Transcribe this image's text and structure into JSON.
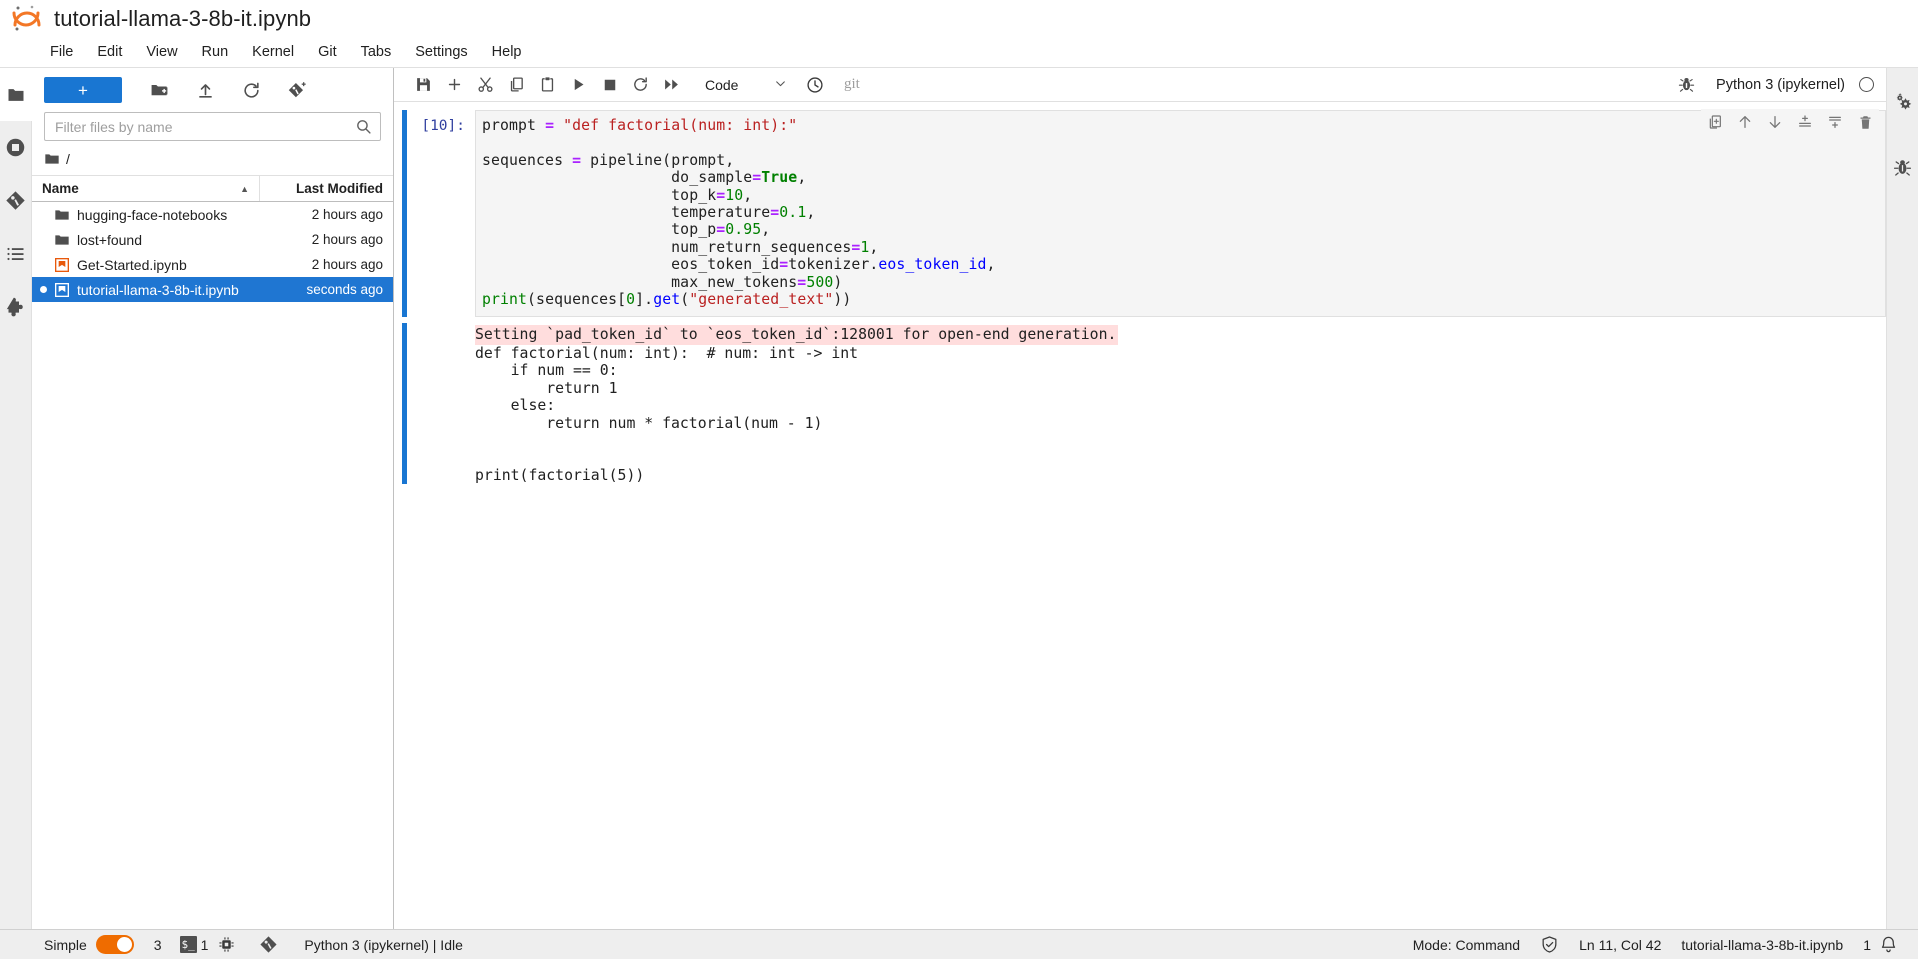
{
  "window": {
    "logo": "jupyter-logo",
    "title": "tutorial-llama-3-8b-it.ipynb"
  },
  "menubar": {
    "items": [
      {
        "label": "File",
        "name": "menu-file"
      },
      {
        "label": "Edit",
        "name": "menu-edit"
      },
      {
        "label": "View",
        "name": "menu-view"
      },
      {
        "label": "Run",
        "name": "menu-run"
      },
      {
        "label": "Kernel",
        "name": "menu-kernel"
      },
      {
        "label": "Git",
        "name": "menu-git"
      },
      {
        "label": "Tabs",
        "name": "menu-tabs"
      },
      {
        "label": "Settings",
        "name": "menu-settings"
      },
      {
        "label": "Help",
        "name": "menu-help"
      }
    ]
  },
  "left_sidebar": {
    "items": [
      {
        "name": "file-browser-icon",
        "icon": "folder",
        "active": true
      },
      {
        "name": "running-terminals-icon",
        "icon": "stop-circle",
        "active": false
      },
      {
        "name": "git-icon",
        "icon": "git-diamond",
        "active": false
      },
      {
        "name": "table-of-contents-icon",
        "icon": "list",
        "active": false
      },
      {
        "name": "extension-manager-icon",
        "icon": "puzzle",
        "active": false
      }
    ]
  },
  "right_sidebar": {
    "items": [
      {
        "name": "property-inspector-icon",
        "icon": "gears"
      },
      {
        "name": "debugger-icon",
        "icon": "bug"
      }
    ]
  },
  "filebrowser": {
    "toolbar": {
      "new_launcher_label": "+",
      "new_folder_name": "new-folder-icon",
      "upload_name": "upload-icon",
      "refresh_name": "refresh-icon",
      "new_checkpoint_name": "git-clone-icon"
    },
    "filter": {
      "placeholder": "Filter files by name",
      "value": ""
    },
    "breadcrumb": "/",
    "columns": {
      "name": "Name",
      "last_modified": "Last Modified"
    },
    "rows": [
      {
        "name": "hugging-face-notebooks",
        "modified": "2 hours ago",
        "kind": "folder",
        "selected": false,
        "dirty": false
      },
      {
        "name": "lost+found",
        "modified": "2 hours ago",
        "kind": "folder",
        "selected": false,
        "dirty": false
      },
      {
        "name": "Get-Started.ipynb",
        "modified": "2 hours ago",
        "kind": "notebook",
        "selected": false,
        "dirty": false
      },
      {
        "name": "tutorial-llama-3-8b-it.ipynb",
        "modified": "seconds ago",
        "kind": "notebook",
        "selected": true,
        "dirty": true
      }
    ]
  },
  "notebook_toolbar": {
    "buttons": [
      {
        "name": "save-button",
        "icon": "save"
      },
      {
        "name": "insert-cell-button",
        "icon": "plus"
      },
      {
        "name": "cut-cell-button",
        "icon": "scissors"
      },
      {
        "name": "copy-cell-button",
        "icon": "copy"
      },
      {
        "name": "paste-cell-button",
        "icon": "paste"
      },
      {
        "name": "run-cell-button",
        "icon": "play"
      },
      {
        "name": "interrupt-kernel-button",
        "icon": "stop"
      },
      {
        "name": "restart-kernel-button",
        "icon": "restart"
      },
      {
        "name": "restart-and-run-all-button",
        "icon": "fast-forward"
      }
    ],
    "cell_type": "Code",
    "history_icon": "clock-icon",
    "git_label": "git",
    "kernel": {
      "debugger_icon": "bug-icon",
      "name": "Python 3 (ipykernel)",
      "status_icon": "kernel-idle-circle"
    }
  },
  "cell_toolbar": {
    "buttons": [
      {
        "name": "duplicate-cell-button",
        "icon": "duplicate"
      },
      {
        "name": "move-cell-up-button",
        "icon": "arrow-up"
      },
      {
        "name": "move-cell-down-button",
        "icon": "arrow-down"
      },
      {
        "name": "insert-cell-above-button",
        "icon": "insert-above"
      },
      {
        "name": "insert-cell-below-button",
        "icon": "insert-below"
      },
      {
        "name": "delete-cell-button",
        "icon": "trash"
      }
    ]
  },
  "cells": [
    {
      "prompt": "[10]:",
      "type": "code",
      "source_lines": [
        "prompt = \"def factorial(num: int):\"",
        "",
        "sequences = pipeline(prompt,",
        "                     do_sample=True,",
        "                     top_k=10,",
        "                     temperature=0.1,",
        "                     top_p=0.95,",
        "                     num_return_sequences=1,",
        "                     eos_token_id=tokenizer.eos_token_id,",
        "                     max_new_tokens=500)",
        "print(sequences[0].get(\"generated_text\"))"
      ],
      "outputs": [
        {
          "stream": "stderr",
          "text": "Setting `pad_token_id` to `eos_token_id`:128001 for open-end generation."
        },
        {
          "stream": "stdout",
          "text": "def factorial(num: int):  # num: int -> int\n    if num == 0:\n        return 1\n    else:\n        return num * factorial(num - 1)\n\n\nprint(factorial(5))"
        }
      ]
    }
  ],
  "statusbar": {
    "simple_label": "Simple",
    "simple_toggle_on": true,
    "kernel_count": "3",
    "terminal_badge": "$_",
    "terminal_count": "1",
    "cpu_icon": "cpu-icon",
    "git_icon": "git-icon",
    "kernel_status": "Python 3 (ipykernel) | Idle",
    "mode": "Mode: Command",
    "trust_icon": "trusted-shield-icon",
    "cursor_position": "Ln 11, Col 42",
    "filename": "tutorial-llama-3-8b-it.ipynb",
    "notification_count": "1",
    "notification_icon": "bell-icon"
  },
  "colors": {
    "accent_blue": "#1976d2",
    "selection_blue": "#1f76d2",
    "stderr_pink": "#ffdddd",
    "toggle_orange": "#ef6c00",
    "string_red": "#BA2121",
    "keyword_green": "#008000",
    "operator_purple": "#AA22FF",
    "function_blue": "#0000FF",
    "prompt_indigo": "#303F9F"
  }
}
